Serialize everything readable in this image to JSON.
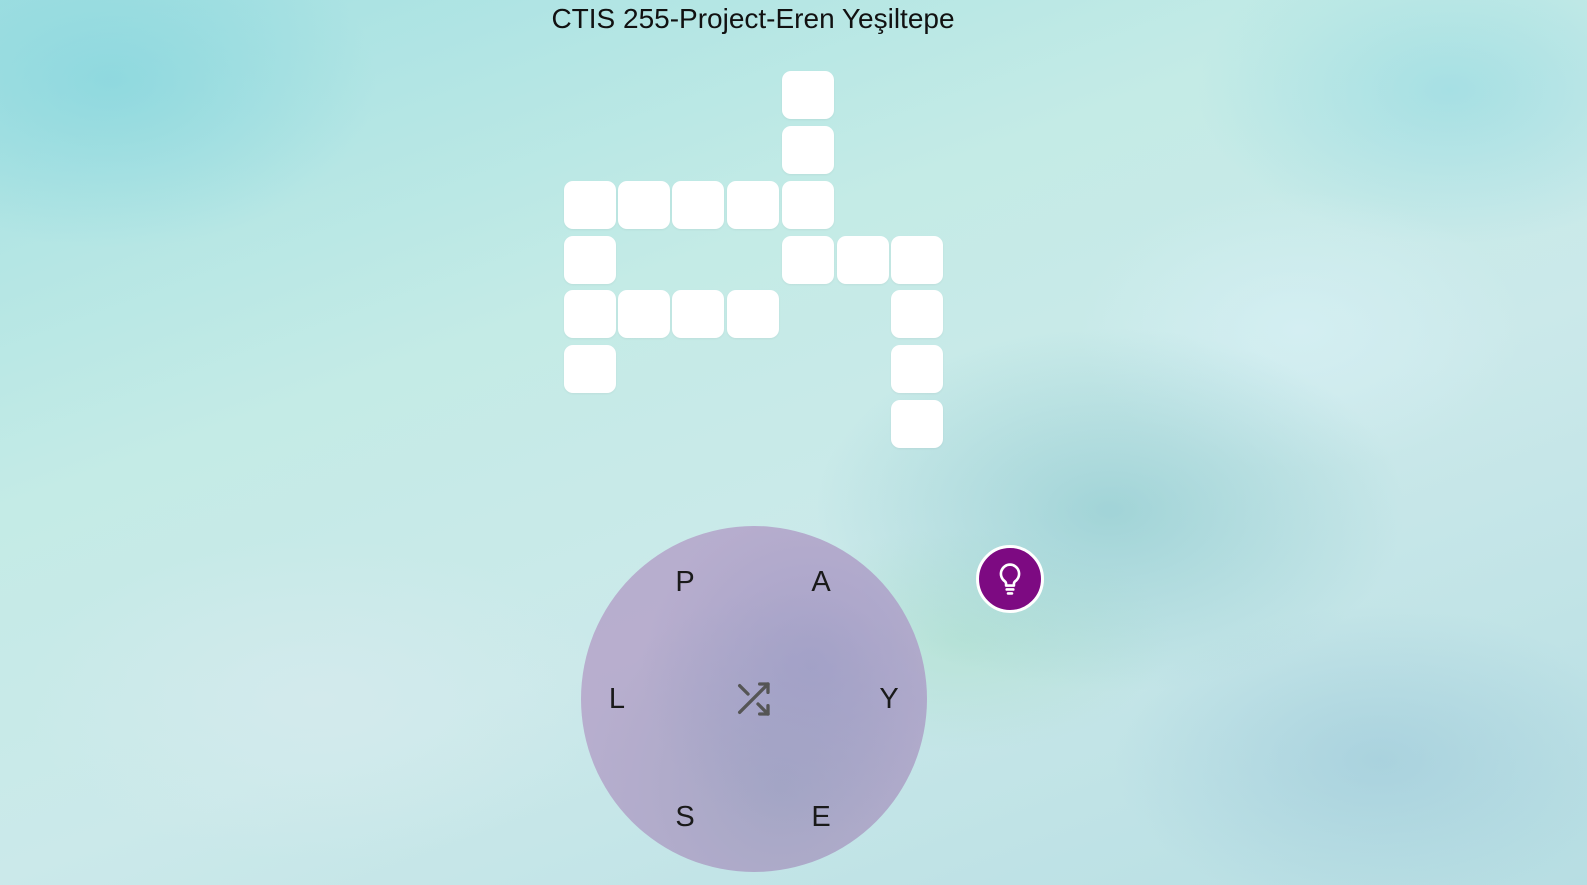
{
  "header": {
    "title": "CTIS 255-Project-Eren Yeşiltepe"
  },
  "wheel": {
    "letters": [
      "P",
      "A",
      "Y",
      "E",
      "S",
      "L"
    ],
    "shuffle_icon": "shuffle-icon",
    "color": "#b7abcd"
  },
  "hint": {
    "icon": "lightbulb-icon",
    "color": "#7d0a82"
  },
  "grid": {
    "cell_color": "#ffffff",
    "filled_letters": []
  }
}
